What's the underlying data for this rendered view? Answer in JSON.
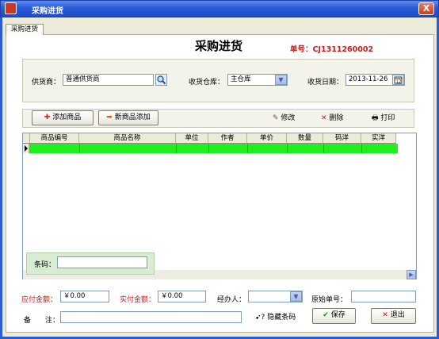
{
  "window": {
    "title": "采购进货",
    "close_label": "X"
  },
  "tab": {
    "label": "采购进货"
  },
  "header": {
    "title": "采购进货",
    "order_no": "单号：CJ1311260002"
  },
  "form": {
    "supplier_label": "供货商：",
    "supplier_value": "普通供货商",
    "warehouse_label": "收货仓库：",
    "warehouse_value": "主仓库",
    "date_label": "收货日期：",
    "date_value": "2013-11-26"
  },
  "toolbar": {
    "add_product": "添加商品",
    "add_new_product": "新商品添加",
    "edit": "修改",
    "delete": "删除",
    "print": "打印"
  },
  "grid": {
    "columns": [
      "商品编号",
      "商品名称",
      "单位",
      "作者",
      "单价",
      "数量",
      "码洋",
      "实洋"
    ]
  },
  "barcode": {
    "label": "条码：",
    "value": ""
  },
  "footer": {
    "payable_label": "应付金额：",
    "payable_value": "￥0.00",
    "paid_label": "实付金额：",
    "paid_value": "￥0.00",
    "handler_label": "经办人：",
    "handler_value": "",
    "original_no_label": "原始单号：",
    "original_no_value": "",
    "remark_label": "备　　注：",
    "remark_value": "",
    "hide_barcode": "隐藏条码",
    "save": "保存",
    "exit": "退出"
  },
  "colors": {
    "accent_red": "#c31d1d",
    "row_highlight": "#1df01d",
    "titlebar": "#2a5bd8"
  }
}
